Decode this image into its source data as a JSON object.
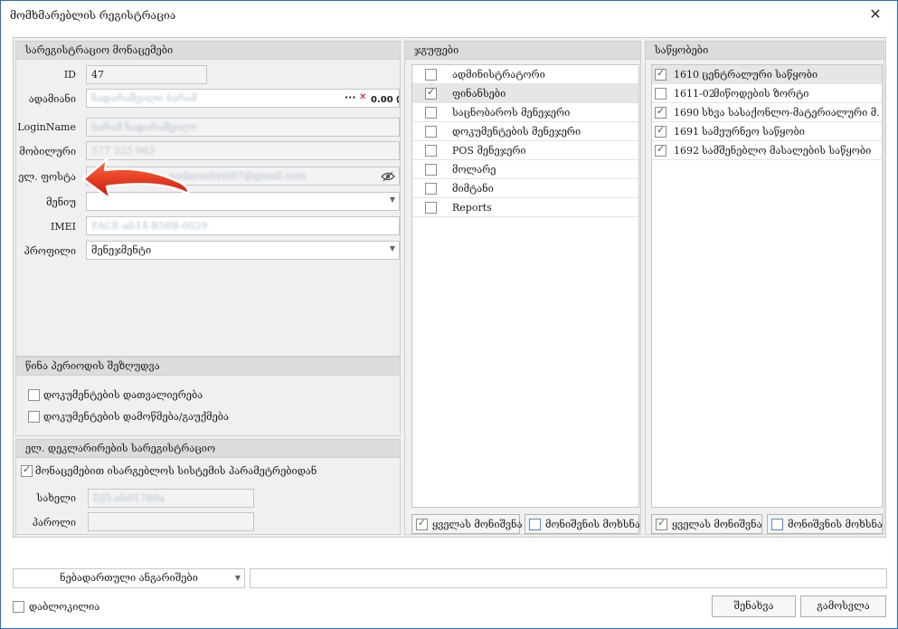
{
  "window": {
    "title": "მომხმარებლის რეგისტრაცია"
  },
  "registration": {
    "header": "სარეგისტრაციო მონაცემები",
    "fields": {
      "id": {
        "label": "ID",
        "value": "47"
      },
      "person": {
        "label": "ადამიანი",
        "value": "ნადარაშვილი ბარამ",
        "dots": "···",
        "clear": "✕",
        "balance": "0.00 ₾"
      },
      "login": {
        "label": "LoginName",
        "value": "ბარამ ნადარაშვილი"
      },
      "mobile": {
        "label": "მობილური",
        "value": "577 225 983"
      },
      "email": {
        "label": "ელ. ფოსტა",
        "value": "nadarashvili87@gmail.com"
      },
      "menu": {
        "label": "მენიუ",
        "value": ""
      },
      "imei": {
        "label": "IMEI",
        "value": "FACE-ab14-B58B-0029"
      },
      "profile": {
        "label": "პროფილი",
        "value": "მენეჯმენტი"
      }
    }
  },
  "previous_period": {
    "header": "წინა პერიოდის შეზღუდვა",
    "options": [
      {
        "label": "დოკუმენტების დათვალიერება",
        "checked": false
      },
      {
        "label": "დოკუმენტების დამოწმება/გაუქმება",
        "checked": false
      }
    ]
  },
  "declarations": {
    "header": "ელ. დეკლარირების სარეგისტრაციო",
    "use_params": {
      "label": "მონაცემებით ისარგებლოს სისტემის პარამეტრებიდან",
      "checked": true
    },
    "username": {
      "label": "სახელი",
      "value": "DJ5-ab01789a"
    },
    "password": {
      "label": "პაროლი",
      "value": ""
    }
  },
  "groups": {
    "header": "ჯგუფები",
    "items": [
      {
        "label": "ადმინისტრატორი",
        "checked": false
      },
      {
        "label": "ფინანსები",
        "checked": true
      },
      {
        "label": "საცნობაროს მენეჯერი",
        "checked": false
      },
      {
        "label": "დოკუმენტების მენეჯერი",
        "checked": false
      },
      {
        "label": "POS მენეჯერი",
        "checked": false
      },
      {
        "label": "მოლარე",
        "checked": false
      },
      {
        "label": "მიმტანი",
        "checked": false
      },
      {
        "label": "Reports",
        "checked": false
      }
    ],
    "select_all": "ყველას მონიშვნა",
    "deselect_all": "მონიშვნის მოხსნა"
  },
  "warehouses": {
    "header": "საწყობები",
    "items": [
      {
        "code": "1610",
        "name": "ცენტრალური საწყობი",
        "checked": true
      },
      {
        "code": "1611-02",
        "name": "მიწოდების ზორტი",
        "checked": false
      },
      {
        "code": "1690",
        "name": "სხვა სასაქონლო-მატერიალური მ...",
        "checked": true
      },
      {
        "code": "1691",
        "name": "სამეურნეო საწყობი",
        "checked": true
      },
      {
        "code": "1692",
        "name": "სამშენებლო მასალების საწყობი",
        "checked": true
      }
    ],
    "select_all": "ყველას მონიშვნა",
    "deselect_all": "მონიშვნის მოხსნა"
  },
  "footer": {
    "accounts_dropdown": "ნებადართული ანგარიშები",
    "accounts_value": "",
    "locked": {
      "label": "დაბლოკილია",
      "checked": false
    },
    "save": "შენახვა",
    "exit": "გამოსვლა"
  },
  "colors": {
    "accent": "#2b6cb8",
    "arrow": "#e02a12",
    "panel_head": "#dcdcdc",
    "balance_red": "#d0021b"
  }
}
